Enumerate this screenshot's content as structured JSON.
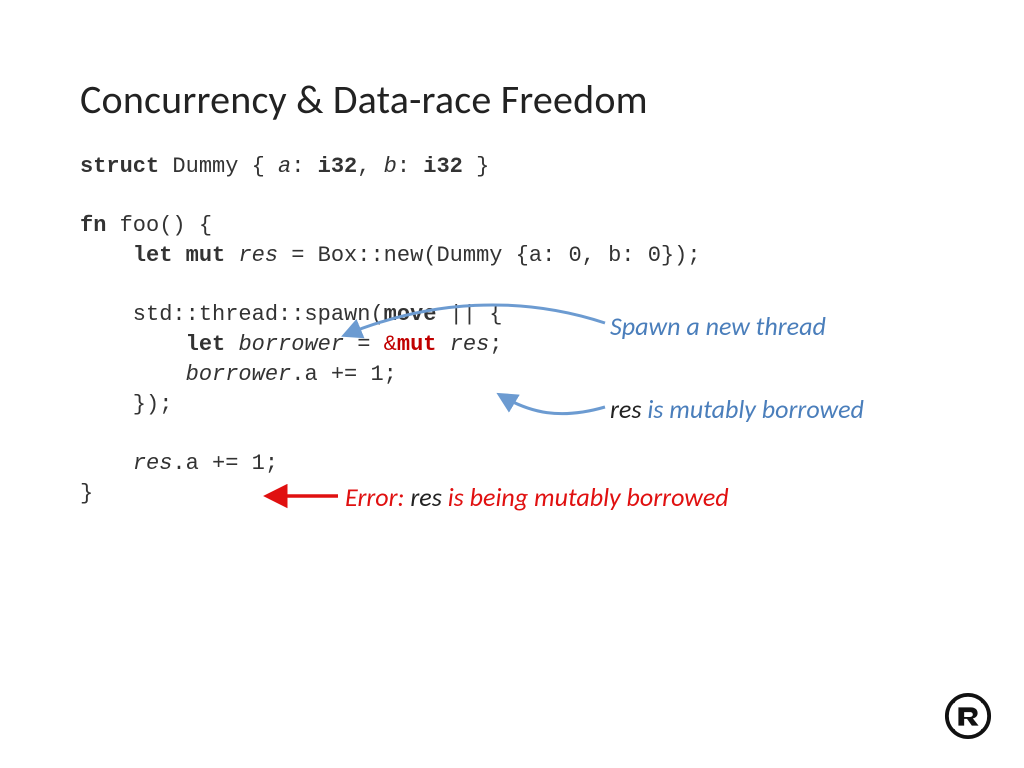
{
  "title": "Concurrency & Data-race Freedom",
  "code": {
    "l1_struct": "struct",
    "l1_name": " Dummy { ",
    "l1_a": "a",
    "l1_a2": ": ",
    "l1_i32a": "i32",
    "l1_c": ", ",
    "l1_b": "b",
    "l1_b2": ": ",
    "l1_i32b": "i32",
    "l1_end": " }",
    "l3_fn": "fn",
    "l3_foo": " foo() {",
    "l4_pre": "    ",
    "l4_let": "let",
    "l4_sp": " ",
    "l4_mut": "mut",
    "l4_sp2": " ",
    "l4_res": "res",
    "l4_rest": " = Box::new(Dummy {a: 0, b: 0});",
    "l6_pre": "    std::thread::spawn(",
    "l6_move": "move",
    "l6_rest": " || {",
    "l7_pre": "        ",
    "l7_let": "let",
    "l7_sp": " ",
    "l7_bor": "borrower",
    "l7_eq": " = ",
    "l7_amp": "&",
    "l7_mut": "mut",
    "l7_sp2": " ",
    "l7_res": "res",
    "l7_end": ";",
    "l8_pre": "        ",
    "l8_bor": "borrower",
    "l8_rest": ".a += 1;",
    "l9": "    });",
    "l11_pre": "    ",
    "l11_res": "res",
    "l11_rest": ".a += 1;",
    "l12": "}"
  },
  "annotations": {
    "spawn": "Spawn a new thread",
    "res1": "res",
    "borrowed": " is mutably borrowed",
    "error": "Error:",
    "res2": " res ",
    "being": "is being mutably borrowed"
  }
}
